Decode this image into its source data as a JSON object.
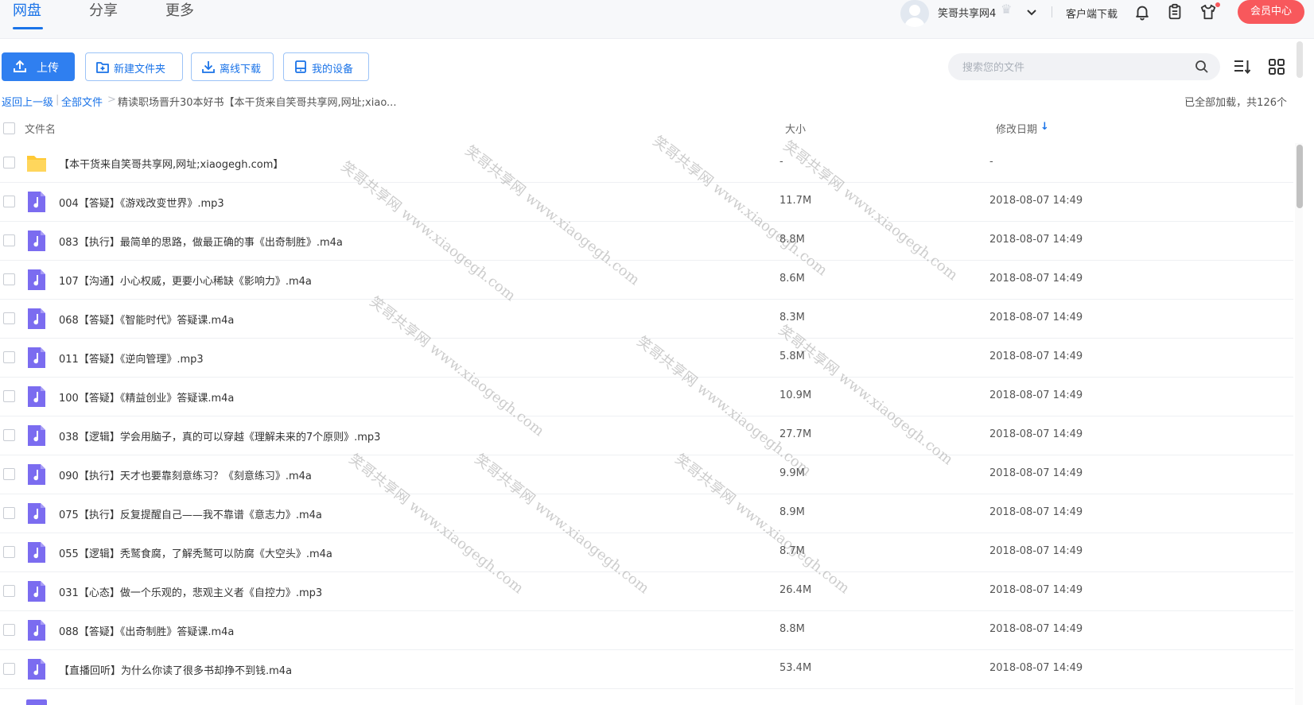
{
  "nav": {
    "tabs": [
      {
        "label": "网盘",
        "active": true
      },
      {
        "label": "分享",
        "active": false
      },
      {
        "label": "更多",
        "active": false
      }
    ]
  },
  "header": {
    "username": "笑哥共享网4",
    "client_download": "客户端下载",
    "vip_button": "会员中心"
  },
  "toolbar": {
    "upload": "上传",
    "new_folder": "新建文件夹",
    "offline_download": "离线下载",
    "my_devices": "我的设备",
    "search_placeholder": "搜索您的文件"
  },
  "breadcrumb": {
    "back": "返回上一级",
    "all_files": "全部文件",
    "current": "精读职场晋升30本好书【本干货来自笑哥共享网,网址;xiao..."
  },
  "load_info": "已全部加载，共126个",
  "columns": {
    "name": "文件名",
    "size": "大小",
    "date": "修改日期",
    "sort_arrow": "↓"
  },
  "files": [
    {
      "name": "【本干货来自笑哥共享网,网址;xiaogegh.com】",
      "size": "-",
      "date": "-",
      "type": "folder"
    },
    {
      "name": "004【答疑】《游戏改变世界》.mp3",
      "size": "11.7M",
      "date": "2018-08-07 14:49",
      "type": "audio"
    },
    {
      "name": "083【执行】最简单的思路，做最正确的事《出奇制胜》.m4a",
      "size": "8.8M",
      "date": "2018-08-07 14:49",
      "type": "audio"
    },
    {
      "name": "107【沟通】小心权威，更要小心稀缺《影响力》.m4a",
      "size": "8.6M",
      "date": "2018-08-07 14:49",
      "type": "audio"
    },
    {
      "name": "068【答疑】《智能时代》答疑课.m4a",
      "size": "8.3M",
      "date": "2018-08-07 14:49",
      "type": "audio"
    },
    {
      "name": "011【答疑】《逆向管理》.mp3",
      "size": "5.8M",
      "date": "2018-08-07 14:49",
      "type": "audio"
    },
    {
      "name": "100【答疑】《精益创业》答疑课.m4a",
      "size": "10.9M",
      "date": "2018-08-07 14:49",
      "type": "audio"
    },
    {
      "name": "038【逻辑】学会用脑子，真的可以穿越《理解未来的7个原则》.mp3",
      "size": "27.7M",
      "date": "2018-08-07 14:49",
      "type": "audio"
    },
    {
      "name": "090【执行】天才也要靠刻意练习？《刻意练习》.m4a",
      "size": "9.9M",
      "date": "2018-08-07 14:49",
      "type": "audio"
    },
    {
      "name": "075【执行】反复提醒自己——我不靠谱《意志力》.m4a",
      "size": "8.9M",
      "date": "2018-08-07 14:49",
      "type": "audio"
    },
    {
      "name": "055【逻辑】秃鹫食腐，了解秃鹫可以防腐《大空头》.m4a",
      "size": "8.7M",
      "date": "2018-08-07 14:49",
      "type": "audio"
    },
    {
      "name": "031【心态】做一个乐观的，悲观主义者《自控力》.mp3",
      "size": "26.4M",
      "date": "2018-08-07 14:49",
      "type": "audio"
    },
    {
      "name": "088【答疑】《出奇制胜》答疑课.m4a",
      "size": "8.8M",
      "date": "2018-08-07 14:49",
      "type": "audio"
    },
    {
      "name": "【直播回听】为什么你读了很多书却挣不到钱.m4a",
      "size": "53.4M",
      "date": "2018-08-07 14:49",
      "type": "audio"
    }
  ],
  "watermark_text": "笑哥共享网 www.xiaogegh.com",
  "colors": {
    "accent": "#1a73e8",
    "vip": "#f8585c",
    "audio_icon": "#7b6cf0",
    "folder_icon": "#ffc935"
  }
}
